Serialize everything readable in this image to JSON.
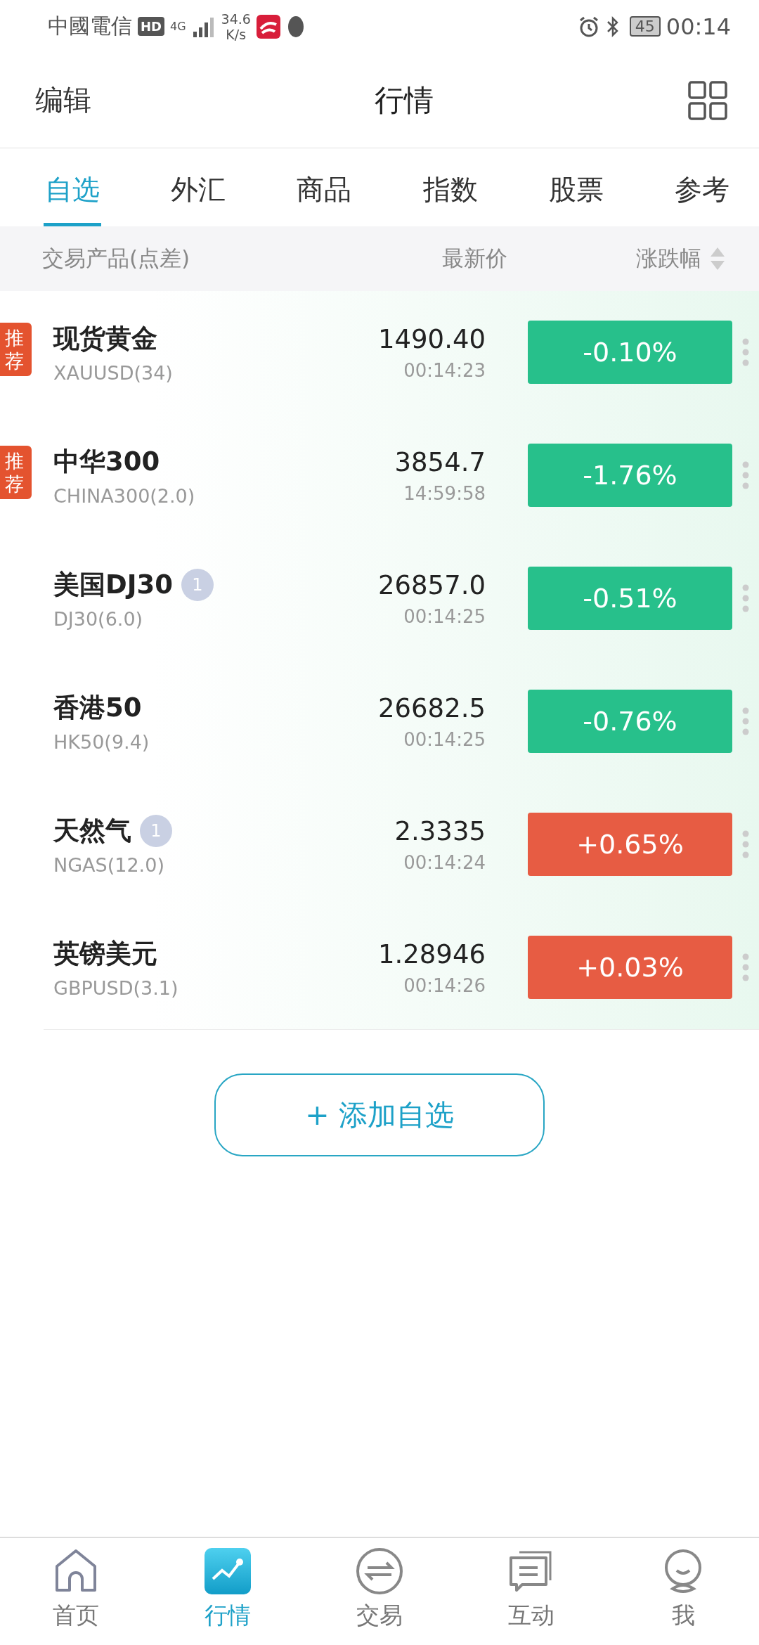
{
  "status_bar": {
    "carrier": "中國電信",
    "hd": "HD",
    "network": "4G",
    "speed": "34.6",
    "speed_unit": "K/s",
    "battery": "45",
    "time": "00:14"
  },
  "header": {
    "left": "编辑",
    "title": "行情"
  },
  "tabs": [
    {
      "label": "自选",
      "selected": true
    },
    {
      "label": "外汇",
      "selected": false
    },
    {
      "label": "商品",
      "selected": false
    },
    {
      "label": "指数",
      "selected": false
    },
    {
      "label": "股票",
      "selected": false
    },
    {
      "label": "参考",
      "selected": false
    }
  ],
  "columns": {
    "product": "交易产品(点差)",
    "price": "最新价",
    "change": "涨跌幅"
  },
  "rows": [
    {
      "name": "现货黄金",
      "code": "XAUUSD(34)",
      "price": "1490.40",
      "time": "00:14:23",
      "change": "-0.10%",
      "color": "#27c08b",
      "tag": "推荐"
    },
    {
      "name": "中华300",
      "code": "CHINA300(2.0)",
      "price": "3854.7",
      "time": "14:59:58",
      "change": "-1.76%",
      "color": "#27c08b",
      "tag": "推荐"
    },
    {
      "name": "美国DJ30",
      "code": "DJ30(6.0)",
      "price": "26857.0",
      "time": "00:14:25",
      "change": "-0.51%",
      "color": "#27c08b",
      "count": "1"
    },
    {
      "name": "香港50",
      "code": "HK50(9.4)",
      "price": "26682.5",
      "time": "00:14:25",
      "change": "-0.76%",
      "color": "#27c08b"
    },
    {
      "name": "天然气",
      "code": "NGAS(12.0)",
      "price": "2.3335",
      "time": "00:14:24",
      "change": "+0.65%",
      "color": "#e75c43",
      "count": "1"
    },
    {
      "name": "英镑美元",
      "code": "GBPUSD(3.1)",
      "price": "1.28946",
      "time": "00:14:26",
      "change": "+0.03%",
      "color": "#e75c43"
    }
  ],
  "add_button": "+ 添加自选",
  "nav": [
    {
      "label": "首页",
      "selected": false
    },
    {
      "label": "行情",
      "selected": true
    },
    {
      "label": "交易",
      "selected": false
    },
    {
      "label": "互动",
      "selected": false
    },
    {
      "label": "我",
      "selected": false
    }
  ]
}
